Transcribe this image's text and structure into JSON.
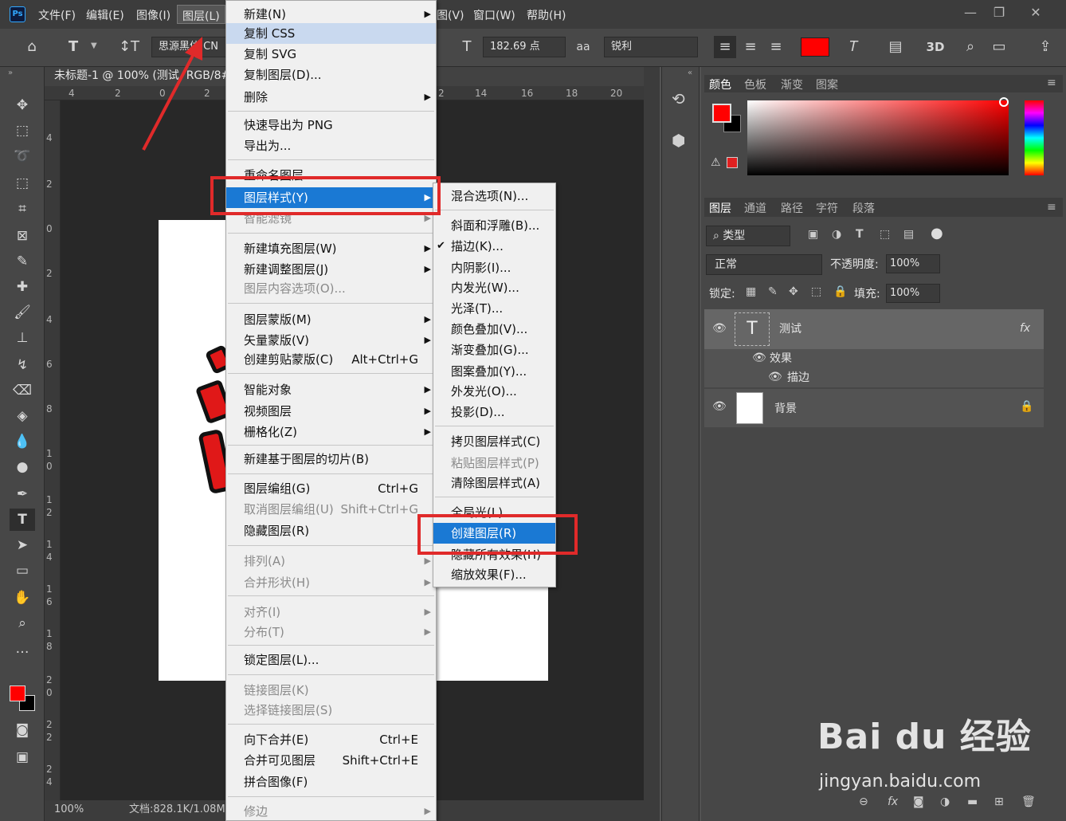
{
  "app": {
    "logo": "Ps"
  },
  "menubar": {
    "items": [
      "文件(F)",
      "编辑(E)",
      "图像(I)",
      "图层(L)"
    ],
    "right_items": [
      "图(V)",
      "窗口(W)",
      "帮助(H)"
    ]
  },
  "window_controls": {
    "minimize": "—",
    "restore": "❐",
    "close": "✕"
  },
  "options_bar": {
    "font_family": "思源黑体 CN",
    "font_size": "182.69 点",
    "antialias": "锐利",
    "threed_label": "3D",
    "text_color": "#ff0000"
  },
  "document": {
    "tab_title": "未标题-1 @ 100% (测试, RGB/8#",
    "zoom": "100%",
    "doc_info": "文档:828.1K/1.08M"
  },
  "ruler": {
    "h": [
      "4",
      "2",
      "0",
      "2",
      "2",
      "14",
      "16",
      "18",
      "20"
    ],
    "v": [
      "4",
      "2",
      "0",
      "2",
      "4",
      "6",
      "8",
      "1",
      "0",
      "1",
      "2",
      "1",
      "4",
      "1",
      "6",
      "1",
      "8",
      "2",
      "0",
      "2",
      "2",
      "2",
      "4"
    ]
  },
  "layer_menu": {
    "items": [
      {
        "label": "新建(N)",
        "sub": true
      },
      {
        "label": "复制 CSS"
      },
      {
        "label": "复制 SVG"
      },
      {
        "label": "复制图层(D)..."
      },
      {
        "label": "删除",
        "sub": true
      },
      {
        "label": "快速导出为 PNG"
      },
      {
        "label": "导出为..."
      },
      {
        "label": "重命名图层..."
      },
      {
        "label": "图层样式(Y)",
        "sub": true
      },
      {
        "label": "智能滤镜",
        "sub": true
      },
      {
        "label": "新建填充图层(W)",
        "sub": true
      },
      {
        "label": "新建调整图层(J)",
        "sub": true
      },
      {
        "label": "图层内容选项(O)..."
      },
      {
        "label": "图层蒙版(M)",
        "sub": true
      },
      {
        "label": "矢量蒙版(V)",
        "sub": true
      },
      {
        "label": "创建剪贴蒙版(C)",
        "shortcut": "Alt+Ctrl+G"
      },
      {
        "label": "智能对象",
        "sub": true
      },
      {
        "label": "视频图层",
        "sub": true
      },
      {
        "label": "栅格化(Z)",
        "sub": true
      },
      {
        "label": "新建基于图层的切片(B)"
      },
      {
        "label": "图层编组(G)",
        "shortcut": "Ctrl+G"
      },
      {
        "label": "取消图层编组(U)",
        "shortcut": "Shift+Ctrl+G"
      },
      {
        "label": "隐藏图层(R)"
      },
      {
        "label": "排列(A)",
        "sub": true
      },
      {
        "label": "合并形状(H)",
        "sub": true
      },
      {
        "label": "对齐(I)",
        "sub": true
      },
      {
        "label": "分布(T)",
        "sub": true
      },
      {
        "label": "锁定图层(L)..."
      },
      {
        "label": "链接图层(K)"
      },
      {
        "label": "选择链接图层(S)"
      },
      {
        "label": "向下合并(E)",
        "shortcut": "Ctrl+E"
      },
      {
        "label": "合并可见图层",
        "shortcut": "Shift+Ctrl+E"
      },
      {
        "label": "拼合图像(F)"
      },
      {
        "label": "修边",
        "sub": true
      }
    ]
  },
  "style_submenu": {
    "items": [
      {
        "label": "混合选项(N)..."
      },
      {
        "label": "斜面和浮雕(B)..."
      },
      {
        "label": "描边(K)...",
        "checked": true
      },
      {
        "label": "内阴影(I)..."
      },
      {
        "label": "内发光(W)..."
      },
      {
        "label": "光泽(T)..."
      },
      {
        "label": "颜色叠加(V)..."
      },
      {
        "label": "渐变叠加(G)..."
      },
      {
        "label": "图案叠加(Y)..."
      },
      {
        "label": "外发光(O)..."
      },
      {
        "label": "投影(D)..."
      },
      {
        "label": "拷贝图层样式(C)"
      },
      {
        "label": "粘贴图层样式(P)"
      },
      {
        "label": "清除图层样式(A)"
      },
      {
        "label": "全局光(L)..."
      },
      {
        "label": "创建图层(R)"
      },
      {
        "label": "隐藏所有效果(H)"
      },
      {
        "label": "缩放效果(F)..."
      }
    ]
  },
  "color_panel": {
    "tabs": [
      "颜色",
      "色板",
      "渐变",
      "图案"
    ],
    "foreground": "#ff0000",
    "background": "#000000"
  },
  "layers_panel": {
    "tabs": [
      "图层",
      "通道",
      "路径",
      "字符",
      "段落"
    ],
    "filter": "类型",
    "blend_mode": "正常",
    "opacity_label": "不透明度:",
    "opacity": "100%",
    "lock_label": "锁定:",
    "fill_label": "填充:",
    "fill": "100%",
    "layers": [
      {
        "name": "测试",
        "thumb": "T",
        "fx": "fx"
      },
      {
        "name": "背景"
      }
    ],
    "effects_label": "效果",
    "effect_stroke": "描边"
  },
  "watermark": {
    "brand": "Bai du 经验",
    "url": "jingyan.baidu.com"
  }
}
